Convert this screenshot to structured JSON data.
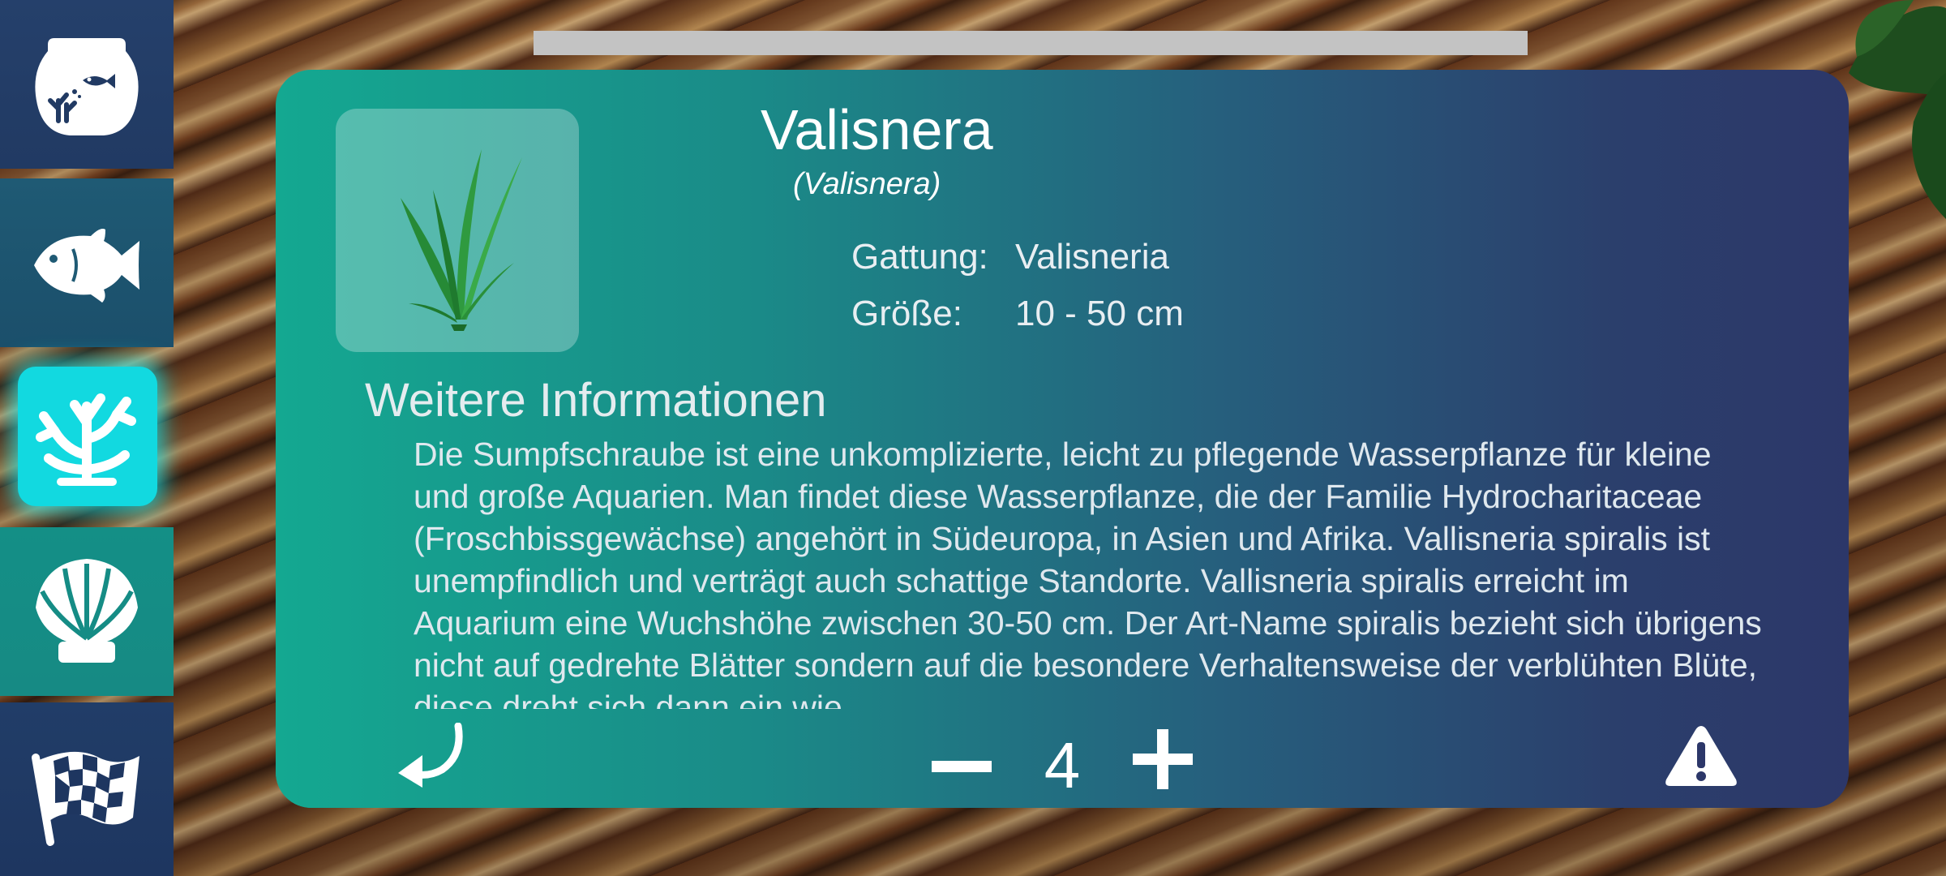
{
  "sidebar": {
    "items": [
      {
        "icon": "aquarium-icon",
        "active": false
      },
      {
        "icon": "fish-icon",
        "active": false
      },
      {
        "icon": "coral-icon",
        "active": true
      },
      {
        "icon": "shell-icon",
        "active": false
      },
      {
        "icon": "checkered-flag-icon",
        "active": false
      }
    ],
    "active_color": "#12d9e0"
  },
  "detail": {
    "title": "Valisnera",
    "subtitle": "(Valisnera)",
    "genus_label": "Gattung:",
    "genus_value": "Valisneria",
    "size_label": "Größe:",
    "size_value": "10 - 50 cm",
    "section_title": "Weitere Informationen",
    "description": "Die Sumpfschraube ist eine unkomplizierte, leicht zu pflegende Wasserpflanze für kleine und große Aquarien. Man findet diese Wasserpflanze, die der Familie Hydrocharitaceae (Froschbissgewächse) angehört in Südeuropa, in Asien und Afrika. Vallisneria spiralis ist unempfindlich und verträgt auch schattige Standorte. Vallisneria spiralis erreicht im Aquarium eine Wuchshöhe zwischen 30-50 cm. Der Art-Name spiralis bezieht sich übrigens nicht auf gedrehte Blätter sondern auf die besondere Verhaltensweise der verblühten Blüte, diese dreht sich dann ein wie"
  },
  "controls": {
    "count": "4"
  }
}
